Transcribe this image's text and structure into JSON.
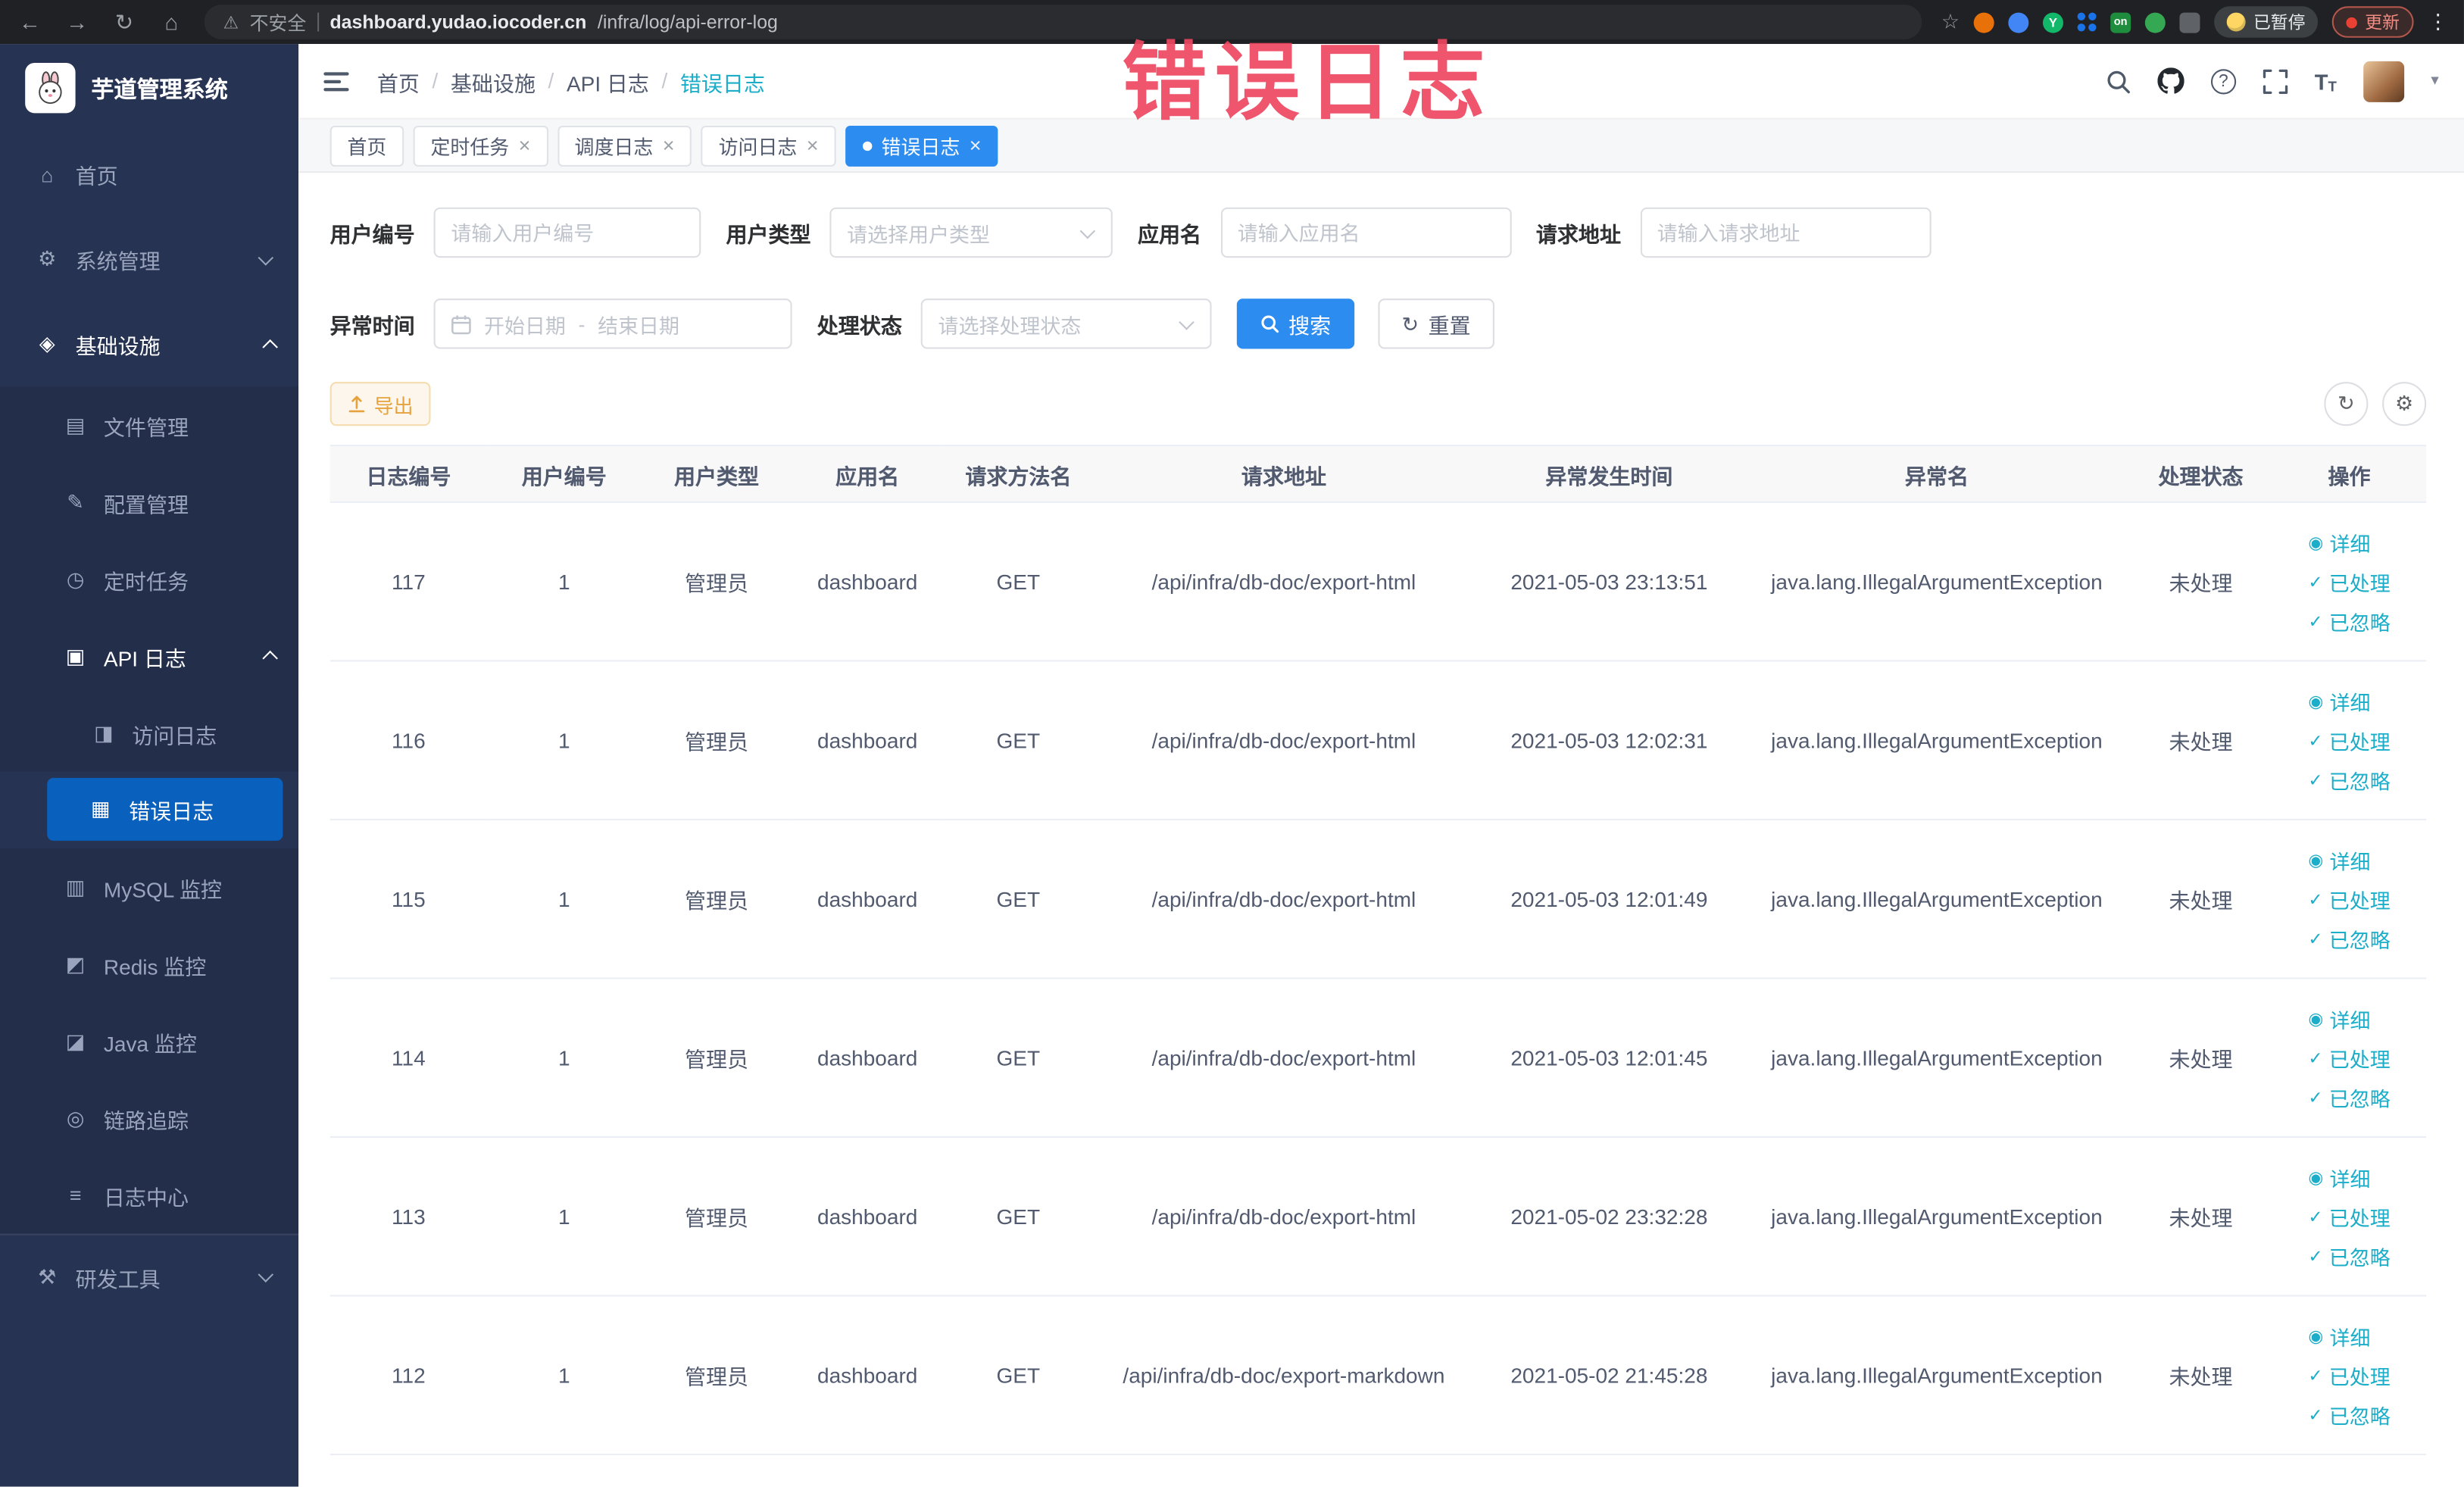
{
  "watermark": "错误日志",
  "browser": {
    "security_label": "不安全",
    "url_host": "dashboard.yudao.iocoder.cn",
    "url_path": "/infra/log/api-error-log",
    "extension_badge": "on",
    "extension_letter": "Y",
    "paused_badge": "已暂停",
    "update_button": "更新"
  },
  "sidebar": {
    "logo_title": "芋道管理系统",
    "items": [
      {
        "label": "首页",
        "icon": "home-icon",
        "level": 1
      },
      {
        "label": "系统管理",
        "icon": "gear-icon",
        "level": 1,
        "chevron": "down"
      },
      {
        "label": "基础设施",
        "icon": "infra-icon",
        "level": 1,
        "chevron": "up",
        "trail": true
      },
      {
        "label": "文件管理",
        "icon": "file-icon",
        "level": 2
      },
      {
        "label": "配置管理",
        "icon": "config-icon",
        "level": 2
      },
      {
        "label": "定时任务",
        "icon": "timer-icon",
        "level": 2
      },
      {
        "label": "API 日志",
        "icon": "api-log-icon",
        "level": 2,
        "chevron": "up",
        "trail": true
      },
      {
        "label": "访问日志",
        "icon": "access-log-icon",
        "level": 3
      },
      {
        "label": "错误日志",
        "icon": "error-log-icon",
        "level": 3,
        "active": true
      },
      {
        "label": "MySQL 监控",
        "icon": "mysql-icon",
        "level": 2
      },
      {
        "label": "Redis 监控",
        "icon": "redis-icon",
        "level": 2
      },
      {
        "label": "Java 监控",
        "icon": "java-icon",
        "level": 2
      },
      {
        "label": "链路追踪",
        "icon": "trace-icon",
        "level": 2
      },
      {
        "label": "日志中心",
        "icon": "log-center-icon",
        "level": 2
      },
      {
        "label": "研发工具",
        "icon": "devtools-icon",
        "level": 1,
        "chevron": "down",
        "section_top": true
      }
    ]
  },
  "header": {
    "breadcrumbs": [
      "首页",
      "基础设施",
      "API 日志",
      "错误日志"
    ]
  },
  "tabs": [
    {
      "label": "首页",
      "closable": false,
      "active": false
    },
    {
      "label": "定时任务",
      "closable": true,
      "active": false
    },
    {
      "label": "调度日志",
      "closable": true,
      "active": false
    },
    {
      "label": "访问日志",
      "closable": true,
      "active": false
    },
    {
      "label": "错误日志",
      "closable": true,
      "active": true
    }
  ],
  "filters": {
    "user_id": {
      "label": "用户编号",
      "placeholder": "请输入用户编号"
    },
    "user_type": {
      "label": "用户类型",
      "placeholder": "请选择用户类型"
    },
    "app_name": {
      "label": "应用名",
      "placeholder": "请输入应用名"
    },
    "request_url": {
      "label": "请求地址",
      "placeholder": "请输入请求地址"
    },
    "exception_time": {
      "label": "异常时间",
      "start_placeholder": "开始日期",
      "separator": "-",
      "end_placeholder": "结束日期"
    },
    "process_status": {
      "label": "处理状态",
      "placeholder": "请选择处理状态"
    },
    "search_button": "搜索",
    "reset_button": "重置"
  },
  "toolbar": {
    "export_label": "导出"
  },
  "table": {
    "columns": [
      "日志编号",
      "用户编号",
      "用户类型",
      "应用名",
      "请求方法名",
      "请求地址",
      "异常发生时间",
      "异常名",
      "处理状态",
      "操作"
    ],
    "rows": [
      {
        "log_id": "117",
        "user_id": "1",
        "user_type": "管理员",
        "app_name": "dashboard",
        "method": "GET",
        "url": "/api/infra/db-doc/export-html",
        "time": "2021-05-03 23:13:51",
        "exception": "java.lang.IllegalArgumentException",
        "status": "未处理"
      },
      {
        "log_id": "116",
        "user_id": "1",
        "user_type": "管理员",
        "app_name": "dashboard",
        "method": "GET",
        "url": "/api/infra/db-doc/export-html",
        "time": "2021-05-03 12:02:31",
        "exception": "java.lang.IllegalArgumentException",
        "status": "未处理"
      },
      {
        "log_id": "115",
        "user_id": "1",
        "user_type": "管理员",
        "app_name": "dashboard",
        "method": "GET",
        "url": "/api/infra/db-doc/export-html",
        "time": "2021-05-03 12:01:49",
        "exception": "java.lang.IllegalArgumentException",
        "status": "未处理"
      },
      {
        "log_id": "114",
        "user_id": "1",
        "user_type": "管理员",
        "app_name": "dashboard",
        "method": "GET",
        "url": "/api/infra/db-doc/export-html",
        "time": "2021-05-03 12:01:45",
        "exception": "java.lang.IllegalArgumentException",
        "status": "未处理"
      },
      {
        "log_id": "113",
        "user_id": "1",
        "user_type": "管理员",
        "app_name": "dashboard",
        "method": "GET",
        "url": "/api/infra/db-doc/export-html",
        "time": "2021-05-02 23:32:28",
        "exception": "java.lang.IllegalArgumentException",
        "status": "未处理"
      },
      {
        "log_id": "112",
        "user_id": "1",
        "user_type": "管理员",
        "app_name": "dashboard",
        "method": "GET",
        "url": "/api/infra/db-doc/export-markdown",
        "time": "2021-05-02 21:45:28",
        "exception": "java.lang.IllegalArgumentException",
        "status": "未处理"
      }
    ],
    "row_actions": [
      "详细",
      "已处理",
      "已忽略"
    ]
  },
  "colors": {
    "primary": "#2d8cf0",
    "link": "#1cadc9",
    "sidebar_active": "#0960bd",
    "watermark": "#ee4760",
    "warning_text": "#e6a23c"
  }
}
